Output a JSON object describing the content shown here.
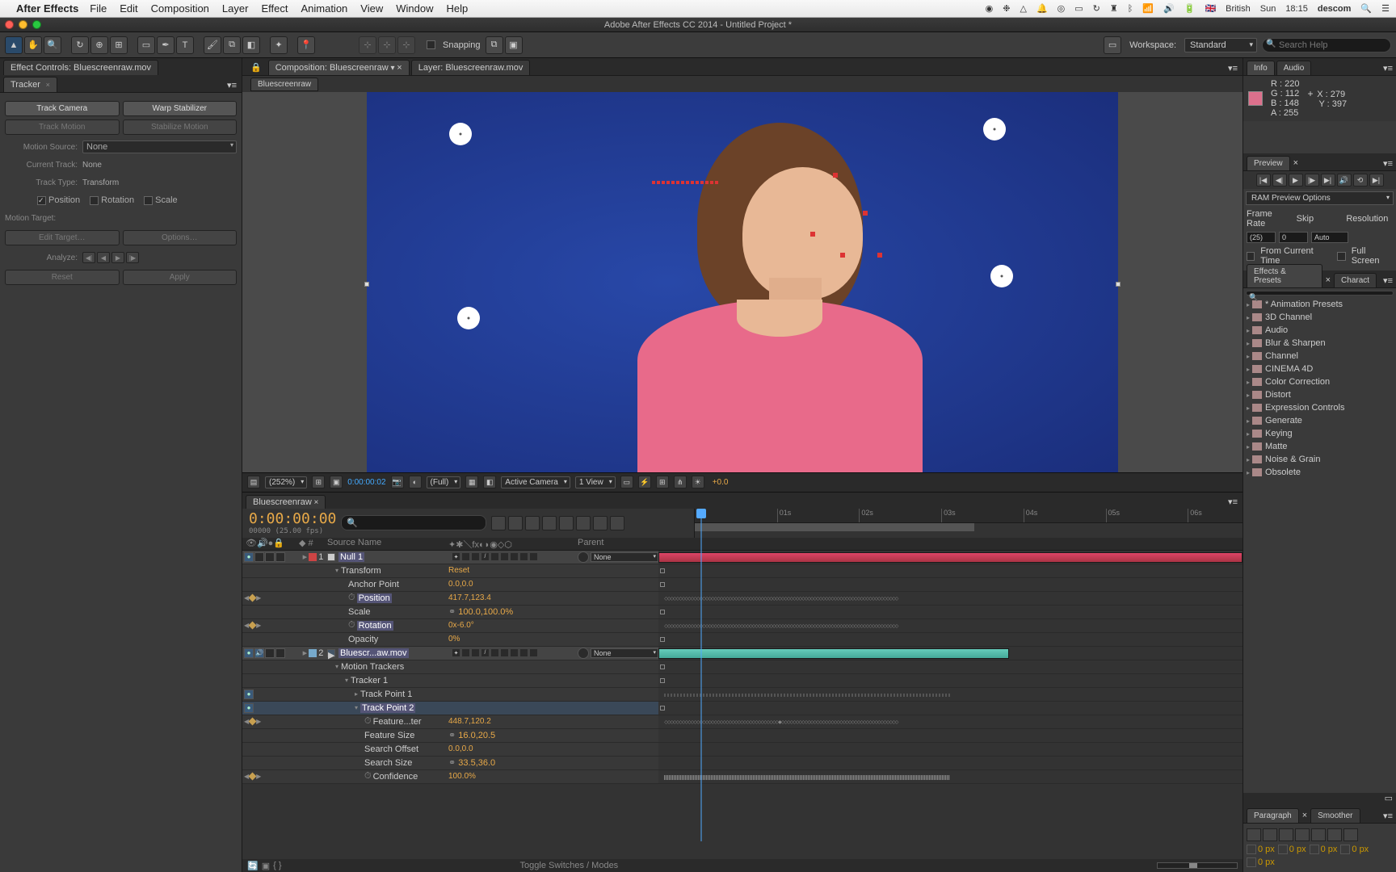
{
  "menubar": {
    "app": "After Effects",
    "menus": [
      "File",
      "Edit",
      "Composition",
      "Layer",
      "Effect",
      "Animation",
      "View",
      "Window",
      "Help"
    ],
    "right": {
      "flag": "🇬🇧",
      "lang": "British",
      "day": "Sun",
      "time": "18:15",
      "user": "descom"
    }
  },
  "window_title": "Adobe After Effects CC 2014 - Untitled Project *",
  "toolbar": {
    "snapping": "Snapping",
    "workspace_label": "Workspace:",
    "workspace": "Standard",
    "search_placeholder": "Search Help"
  },
  "left": {
    "tab1": "Effect Controls: Bluescreenraw.mov",
    "tab2": "Tracker",
    "btns": {
      "track_camera": "Track Camera",
      "warp_stab": "Warp Stabilizer",
      "track_motion": "Track Motion",
      "stab_motion": "Stabilize Motion"
    },
    "motion_source_lbl": "Motion Source:",
    "motion_source": "None",
    "current_track_lbl": "Current Track:",
    "current_track": "None",
    "track_type_lbl": "Track Type:",
    "track_type": "Transform",
    "position": "Position",
    "rotation": "Rotation",
    "scale": "Scale",
    "motion_target_lbl": "Motion Target:",
    "edit_target": "Edit Target…",
    "options": "Options…",
    "analyze_lbl": "Analyze:",
    "reset": "Reset",
    "apply": "Apply"
  },
  "viewer": {
    "comp_tab": "Composition: Bluescreenraw",
    "layer_tab": "Layer: Bluescreenraw.mov",
    "subtab": "Bluescreenraw",
    "footer": {
      "zoom": "(252%)",
      "time": "0:00:00:02",
      "res": "(Full)",
      "camera": "Active Camera",
      "views": "1 View",
      "exposure": "+0.0"
    }
  },
  "info": {
    "tab1": "Info",
    "tab2": "Audio",
    "r": "R : 220",
    "g": "G : 112",
    "b": "B : 148",
    "a": "A : 255",
    "x": "X : 279",
    "y": "Y : 397"
  },
  "preview": {
    "tab": "Preview",
    "ram": "RAM Preview Options",
    "framerate_lbl": "Frame Rate",
    "skip_lbl": "Skip",
    "res_lbl": "Resolution",
    "framerate": "(25)",
    "skip": "0",
    "res": "Auto",
    "from_current": "From Current Time",
    "fullscreen": "Full Screen"
  },
  "effects": {
    "tab1": "Effects & Presets",
    "tab2": "Charact",
    "items": [
      "* Animation Presets",
      "3D Channel",
      "Audio",
      "Blur & Sharpen",
      "Channel",
      "CINEMA 4D",
      "Color Correction",
      "Distort",
      "Expression Controls",
      "Generate",
      "Keying",
      "Matte",
      "Noise & Grain",
      "Obsolete"
    ]
  },
  "paragraph": {
    "tab1": "Paragraph",
    "tab2": "Smoother",
    "px": "0 px"
  },
  "timeline": {
    "tab": "Bluescreenraw",
    "timecode": "0:00:00:00",
    "timecode_sub": "00000 (25.00 fps)",
    "cols": {
      "source": "Source Name",
      "parent": "Parent"
    },
    "ruler": [
      "01s",
      "02s",
      "03s",
      "04s",
      "05s",
      "06s"
    ],
    "layer1": {
      "num": "1",
      "name": "Null 1",
      "parent": "None"
    },
    "layer2": {
      "num": "2",
      "name": "Bluescr...aw.mov",
      "parent": "None"
    },
    "transform": "Transform",
    "reset": "Reset",
    "anchor": {
      "name": "Anchor Point",
      "val": "0.0,0.0"
    },
    "position": {
      "name": "Position",
      "val": "417.7,123.4"
    },
    "scale": {
      "name": "Scale",
      "val": "100.0,100.0%"
    },
    "rotation": {
      "name": "Rotation",
      "val": "0x-6.0°"
    },
    "opacity": {
      "name": "Opacity",
      "val": "0%"
    },
    "motion_trackers": "Motion Trackers",
    "tracker1": "Tracker 1",
    "tp1": "Track Point 1",
    "tp2": "Track Point 2",
    "feature": {
      "name": "Feature...ter",
      "val": "448.7,120.2"
    },
    "feature_size": {
      "name": "Feature Size",
      "val": "16.0,20.5"
    },
    "search_offset": {
      "name": "Search Offset",
      "val": "0.0,0.0"
    },
    "search_size": {
      "name": "Search Size",
      "val": "33.5,36.0"
    },
    "confidence": {
      "name": "Confidence",
      "val": "100.0%"
    },
    "toggle_switches": "Toggle Switches / Modes"
  }
}
